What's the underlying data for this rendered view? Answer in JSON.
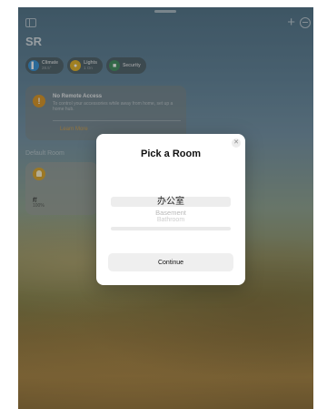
{
  "window": {
    "title": "SR"
  },
  "toolbar": {
    "sidebar_icon": "sidebar-icon",
    "add_icon": "plus-icon",
    "more_icon": "ellipsis-circle-icon"
  },
  "chips": [
    {
      "icon": "thermometer-icon",
      "color": "#2f8fd6",
      "title": "Climate",
      "sub": "28.5°"
    },
    {
      "icon": "lightbulb-icon",
      "color": "#e0b020",
      "title": "Lights",
      "sub": "1 On"
    },
    {
      "icon": "lock-icon",
      "color": "#3a8a5a",
      "title": "Security",
      "sub": ""
    }
  ],
  "notice": {
    "title": "No Remote Access",
    "body": "To control your accessories while away from home, set up a home hub.",
    "link": "Learn More"
  },
  "room_section": {
    "label": "Default Room"
  },
  "accessory_tile": {
    "name": "灯",
    "status": "100%"
  },
  "modal": {
    "title": "Pick a Room",
    "options": [
      "办公室",
      "Basement",
      "Bathroom"
    ],
    "selected": "办公室",
    "button": "Continue"
  },
  "colors": {
    "accent": "#d9921c",
    "modal_bg": "#ffffff",
    "button_bg": "#efefef"
  }
}
